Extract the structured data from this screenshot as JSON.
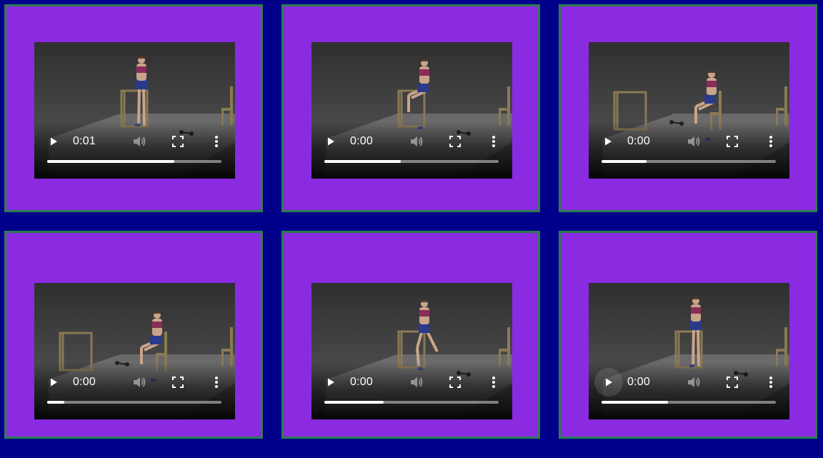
{
  "colors": {
    "page_background": "#00008b",
    "tile_background": "#8a2be2",
    "tile_border": "#2e7d4f",
    "progress_played": "#ffffff",
    "progress_track": "#b0b0b0"
  },
  "icons": {
    "play": "play-icon",
    "mute": "volume-icon",
    "fullscreen": "fullscreen-icon",
    "more": "more-vertical-icon"
  },
  "videos": [
    {
      "time": "0:01",
      "progress": 0.73,
      "scene": "stand-at-rail",
      "play_hover": false
    },
    {
      "time": "0:00",
      "progress": 0.44,
      "scene": "lunge-at-rail",
      "play_hover": false
    },
    {
      "time": "0:00",
      "progress": 0.26,
      "scene": "seated-leg-extension",
      "play_hover": false
    },
    {
      "time": "0:00",
      "progress": 0.1,
      "scene": "seated-frame-left",
      "play_hover": false
    },
    {
      "time": "0:00",
      "progress": 0.34,
      "scene": "lunge-back-at-rail",
      "play_hover": false
    },
    {
      "time": "0:00",
      "progress": 0.38,
      "scene": "stand-at-rail-2",
      "play_hover": true
    }
  ]
}
